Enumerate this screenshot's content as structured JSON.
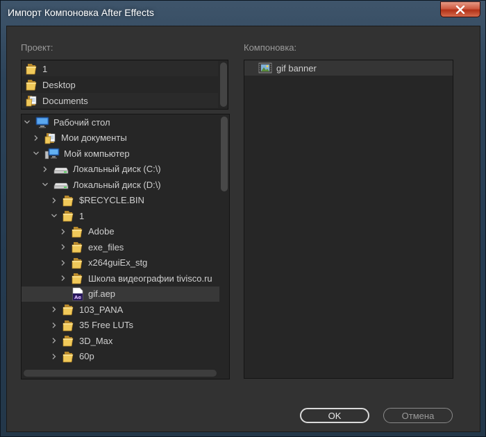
{
  "window": {
    "title": "Импорт Компоновка After Effects"
  },
  "project": {
    "label": "Проект:",
    "recent": [
      {
        "label": "1",
        "icon": "folder-icon"
      },
      {
        "label": "Desktop",
        "icon": "folder-icon"
      },
      {
        "label": "Documents",
        "icon": "document-folder-icon"
      }
    ],
    "tree": [
      {
        "label": "Рабочий стол",
        "icon": "desktop-icon",
        "depth": 0,
        "expander": "expanded"
      },
      {
        "label": "Мои документы",
        "icon": "document-folder-icon",
        "depth": 1,
        "expander": "collapsed"
      },
      {
        "label": "Мой компьютер",
        "icon": "computer-icon",
        "depth": 1,
        "expander": "expanded"
      },
      {
        "label": "Локальный диск (C:\\)",
        "icon": "drive-icon",
        "depth": 2,
        "expander": "collapsed"
      },
      {
        "label": "Локальный диск (D:\\)",
        "icon": "drive-icon",
        "depth": 2,
        "expander": "expanded"
      },
      {
        "label": "$RECYCLE.BIN",
        "icon": "folder-icon",
        "depth": 3,
        "expander": "collapsed"
      },
      {
        "label": "1",
        "icon": "folder-icon",
        "depth": 3,
        "expander": "expanded"
      },
      {
        "label": "Adobe",
        "icon": "folder-icon",
        "depth": 4,
        "expander": "collapsed"
      },
      {
        "label": "exe_files",
        "icon": "folder-icon",
        "depth": 4,
        "expander": "collapsed"
      },
      {
        "label": "x264guiEx_stg",
        "icon": "folder-icon",
        "depth": 4,
        "expander": "collapsed"
      },
      {
        "label": "Школа видеографии tivisco.ru",
        "icon": "folder-icon",
        "depth": 4,
        "expander": "collapsed"
      },
      {
        "label": "gif.aep",
        "icon": "ae-project-icon",
        "depth": 4,
        "expander": "none",
        "selected": true
      },
      {
        "label": "103_PANA",
        "icon": "folder-icon",
        "depth": 3,
        "expander": "collapsed"
      },
      {
        "label": "35 Free LUTs",
        "icon": "folder-icon",
        "depth": 3,
        "expander": "collapsed"
      },
      {
        "label": "3D_Max",
        "icon": "folder-icon",
        "depth": 3,
        "expander": "collapsed"
      },
      {
        "label": "60p",
        "icon": "folder-icon",
        "depth": 3,
        "expander": "collapsed"
      }
    ]
  },
  "composition": {
    "label": "Компоновка:",
    "items": [
      {
        "label": "gif banner",
        "icon": "composition-icon",
        "selected": true
      }
    ]
  },
  "buttons": {
    "ok": "OK",
    "cancel": "Отмена"
  }
}
